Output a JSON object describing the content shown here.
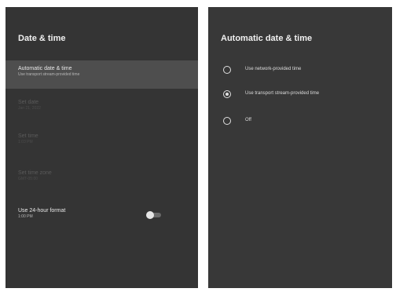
{
  "left": {
    "title": "Date & time",
    "items": [
      {
        "title": "Automatic date & time",
        "subtitle": "Use transport stream-provided time",
        "state": "selected"
      },
      {
        "title": "Set date",
        "subtitle": "Jan 21, 2022",
        "state": "disabled"
      },
      {
        "title": "Set time",
        "subtitle": "1:03 PM",
        "state": "disabled"
      },
      {
        "title": "Set time zone",
        "subtitle": "GMT-05:00",
        "state": "disabled"
      },
      {
        "title": "Use 24-hour format",
        "subtitle": "1:00 PM",
        "state": "normal",
        "toggle_on": false
      }
    ]
  },
  "right": {
    "title": "Automatic date & time",
    "options": [
      {
        "label": "Use network-provided time",
        "selected": false
      },
      {
        "label": "Use transport stream-provided time",
        "selected": true
      },
      {
        "label": "Off",
        "selected": false
      }
    ]
  },
  "colors": {
    "panel_bg": "#343434",
    "selected_bg": "#4e4e4e",
    "text": "#e8e8e8",
    "disabled_text": "#5a5a5a"
  }
}
